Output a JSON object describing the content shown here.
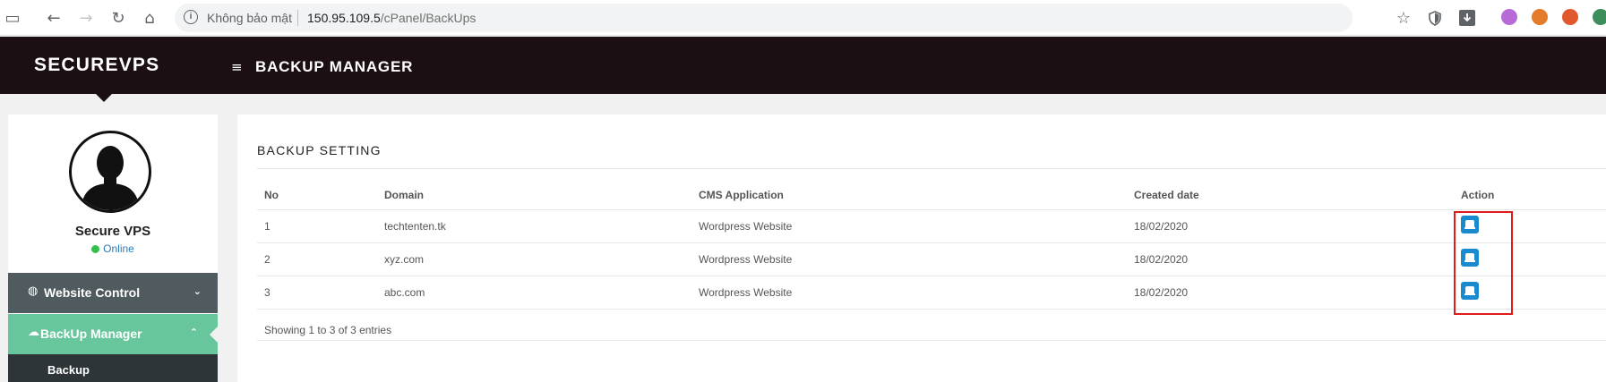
{
  "browser": {
    "security_label": "Không bảo mật",
    "url_host": "150.95.109.5",
    "url_path": "/cPanel/BackUps",
    "nav_icons": [
      "sidebar-icon",
      "back-icon",
      "forward-icon",
      "reload-icon",
      "home-icon"
    ],
    "toolbar_icons": [
      "star-icon",
      "shield-icon",
      "download-icon"
    ],
    "extension_colors": [
      "#b86bd6",
      "#e37b2a",
      "#e0582b",
      "#3c8e5a"
    ]
  },
  "header": {
    "brand": "SECUREVPS",
    "menu_icon": "hamburger-icon",
    "title": "BACKUP MANAGER"
  },
  "sidebar": {
    "user_name": "Secure VPS",
    "status": "Online",
    "status_color": "#35c04d",
    "items": [
      {
        "label": "Website Control",
        "icon": "globe-icon",
        "chevron": "chevron-down-icon",
        "color": "#4f5b5f"
      },
      {
        "label": "BackUp Manager",
        "icon": "cloud-icon",
        "chevron": "chevron-up-icon",
        "color": "#67c69b"
      }
    ],
    "sub_items": [
      {
        "label": "Backup"
      }
    ]
  },
  "main": {
    "card_title": "BACKUP SETTING",
    "table": {
      "columns": [
        "No",
        "Domain",
        "CMS Application",
        "Created date",
        "Action"
      ],
      "rows": [
        {
          "no": "1",
          "domain": "techtenten.tk",
          "cms": "Wordpress Website",
          "created": "18/02/2020"
        },
        {
          "no": "2",
          "domain": "xyz.com",
          "cms": "Wordpress Website",
          "created": "18/02/2020"
        },
        {
          "no": "3",
          "domain": "abc.com",
          "cms": "Wordpress Website",
          "created": "18/02/2020"
        }
      ]
    },
    "entries_info": "Showing 1 to 3 of 3 entries",
    "accent_color": "#1a8ad0",
    "highlight_color": "#e11b1b"
  }
}
